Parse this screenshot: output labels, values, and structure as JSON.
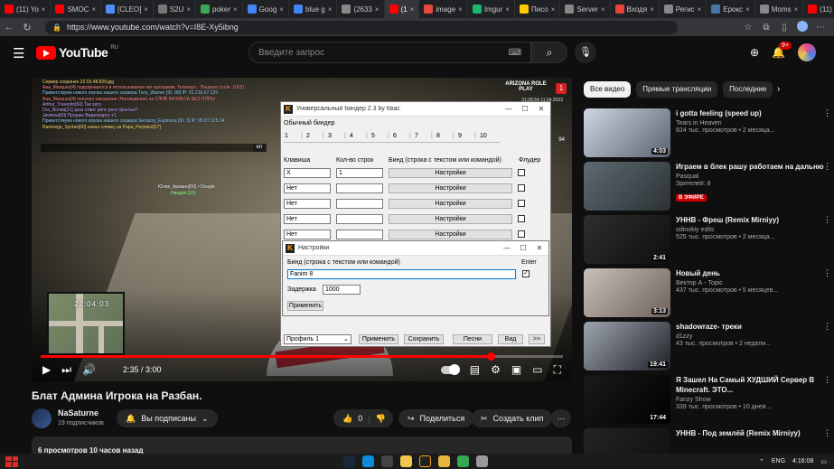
{
  "browser": {
    "tabs": [
      {
        "label": "(11) Yo",
        "color": "#ff0000"
      },
      {
        "label": "SMOC",
        "color": "#ff0000"
      },
      {
        "label": "[CLEO]",
        "color": "#4e8ef7"
      },
      {
        "label": "S2U",
        "color": "#777777"
      },
      {
        "label": "poker",
        "color": "#3aa657"
      },
      {
        "label": "Goog",
        "color": "#4285f4"
      },
      {
        "label": "blue g",
        "color": "#4285f4"
      },
      {
        "label": "(2633",
        "color": "#888888"
      },
      {
        "label": "(1",
        "color": "#ff0000",
        "active": true
      },
      {
        "label": "image",
        "color": "#e64a3c"
      },
      {
        "label": "Imgur",
        "color": "#1bb76e"
      },
      {
        "label": "Писо",
        "color": "#ffcc00"
      },
      {
        "label": "Server",
        "color": "#888888"
      },
      {
        "label": "Входя",
        "color": "#ea4335"
      },
      {
        "label": "Регис",
        "color": "#888888"
      },
      {
        "label": "Ерокс",
        "color": "#4a76a8"
      },
      {
        "label": "Moms",
        "color": "#888888"
      },
      {
        "label": "(11) Г",
        "color": "#ff0000"
      },
      {
        "label": "Beenl",
        "color": "#888888"
      }
    ],
    "new_tab": "+",
    "url": "https://www.youtube.com/watch?v=I8E-Xy5ibng"
  },
  "youtube": {
    "logo_text": "YouTube",
    "logo_region": "RU",
    "search_placeholder": "Введите запрос",
    "notif_count": "9+"
  },
  "video": {
    "chat_lines": [
      {
        "text": "Сервер сохранен 22.03.48.829.jpg",
        "tone": "c2"
      },
      {
        "text": "Aaa_Marquez[4] подозревается в использовании чит-программ: Телепорт - Пешком (code: 1002).",
        "tone": "c3"
      },
      {
        "text": "Приветствуем нового игрока нашего сервера Tony_Warner [ID: 88] IP: 91.216.67.129",
        "tone": "c1"
      },
      {
        "text": "Aaa_Marquez[4] получил наказание (Нахождение) на СЛИВ БИЗНЕСА БЕЗ ОПРЫ",
        "tone": "c3"
      },
      {
        "text": "Arthur_Travedor[60] Так хату",
        "tone": "c4"
      },
      {
        "text": "Dra_Bonda[21] зраз отвит рипс ренс фантык?",
        "tone": "c4"
      },
      {
        "text": "Jawkwa[60] Продаю Видеокарту +1",
        "tone": "c4"
      },
      {
        "text": "Приветствуем нового игрока нашего сервера Seriazzy_Espinoza [ID: 3] IP: 95.87.125.14",
        "tone": "c1"
      },
      {
        "text": "Ramirego_Syntax[60] начал слежку за Papa_Peynekd[17]",
        "tone": "c2"
      }
    ],
    "lang": "en",
    "nametag": "Юлия_Армани[56] • Oxagle",
    "nametag_sub": "Ниндзя (10)",
    "minimap_time": "22:04:03",
    "server_logo": "ARIZONA ROLE PLAY",
    "server_number": "1",
    "hud_info": "01:05:54  11.04.2023",
    "ammo": "94",
    "current_time": "2:35",
    "duration": "3:00",
    "progress_fraction": 0.861
  },
  "binder": {
    "title": "Универсальный биндер 2.3 by Квас",
    "subtitle": "Обычный биндер",
    "tabs": [
      "1",
      "2",
      "3",
      "4",
      "5",
      "6",
      "7",
      "8",
      "9",
      "10"
    ],
    "col_key": "Клавиша",
    "col_count": "Кол-во строк",
    "col_bind": "Бинд (строка с текстом или командой)",
    "col_flood": "Флудер",
    "rows": [
      {
        "key": "X",
        "count": "1",
        "btn": "Настройки"
      },
      {
        "key": "Нет",
        "count": "",
        "btn": "Настройки"
      },
      {
        "key": "Нет",
        "count": "",
        "btn": "Настройки"
      },
      {
        "key": "Нет",
        "count": "",
        "btn": "Настройки"
      },
      {
        "key": "Нет",
        "count": "",
        "btn": "Настройки"
      }
    ],
    "profile": "Профиль 1",
    "btn_apply": "Применить",
    "btn_save": "Сохранить",
    "btn_songs": "Песни",
    "btn_view": "Вид",
    "btn_more": ">>"
  },
  "settings": {
    "title": "Настройки",
    "bind_label": "Бинд (строка с текстом или командой)",
    "enter_label": "Enter",
    "bind_value": "Fanim 8",
    "delay_label": "Задержка",
    "delay_value": "1000",
    "apply": "Применить"
  },
  "below": {
    "title": "Блат Админа Игрока на Разбан.",
    "channel": "NaSaturne",
    "subs": "19 подписчиков",
    "subscribed": "Вы подписаны",
    "likes": "0",
    "share": "Поделиться",
    "clip": "Создать клип",
    "views": "6 просмотров  10 часов назад"
  },
  "sidebar": {
    "chips": [
      "Все видео",
      "Прямые трансляции",
      "Последние"
    ],
    "recs": [
      {
        "title": "i gotta feeling (speed up)",
        "channel": "Tears in Heaven",
        "meta": "824 тыс. просмотров • 2 месяца...",
        "dur": "4:03",
        "c1": "#cfd6e3",
        "c2": "#5a6170"
      },
      {
        "title": "Играем в блек рашу работаем на дальню",
        "channel": "Pasqual",
        "meta": "Зрителей: 8",
        "live": "В ЭФИРЕ",
        "dur": "",
        "c1": "#5d6a70",
        "c2": "#2c3236"
      },
      {
        "title": "УННВ - Фреш (Remix Mirniyy)",
        "channel": "odinokiy edits",
        "meta": "525 тыс. просмотров • 2 месяца...",
        "dur": "2:41",
        "c1": "#2e2e2e",
        "c2": "#0e0e0e"
      },
      {
        "title": "Новый день",
        "channel": "Вектор А - Topic",
        "meta": "437 тыс. просмотров • 5 месяцев...",
        "dur": "3:13",
        "c1": "#c9c0b8",
        "c2": "#6e625b"
      },
      {
        "title": "shadowraze- треки",
        "channel": "d1zzy",
        "meta": "43 тыс. просмотров • 2 недели...",
        "dur": "19:41",
        "c1": "#9ea5b0",
        "c2": "#1f2126"
      },
      {
        "title": "Я Зашел На Самый ХУДШИЙ Сервер В Minecraft. ЭТО...",
        "channel": "Fanzy Show",
        "meta": "339 тыс. просмотров • 10 дней...",
        "dur": "17:44",
        "c1": "#1a1a1a",
        "c2": "#000000"
      },
      {
        "title": "УННВ - Под землёй (Remix Mirniyy)",
        "channel": "",
        "meta": "",
        "dur": "",
        "c1": "#242424",
        "c2": "#0e0e0e"
      }
    ]
  },
  "taskbar": {
    "lang": "ENG",
    "clock": "4:16:08"
  }
}
